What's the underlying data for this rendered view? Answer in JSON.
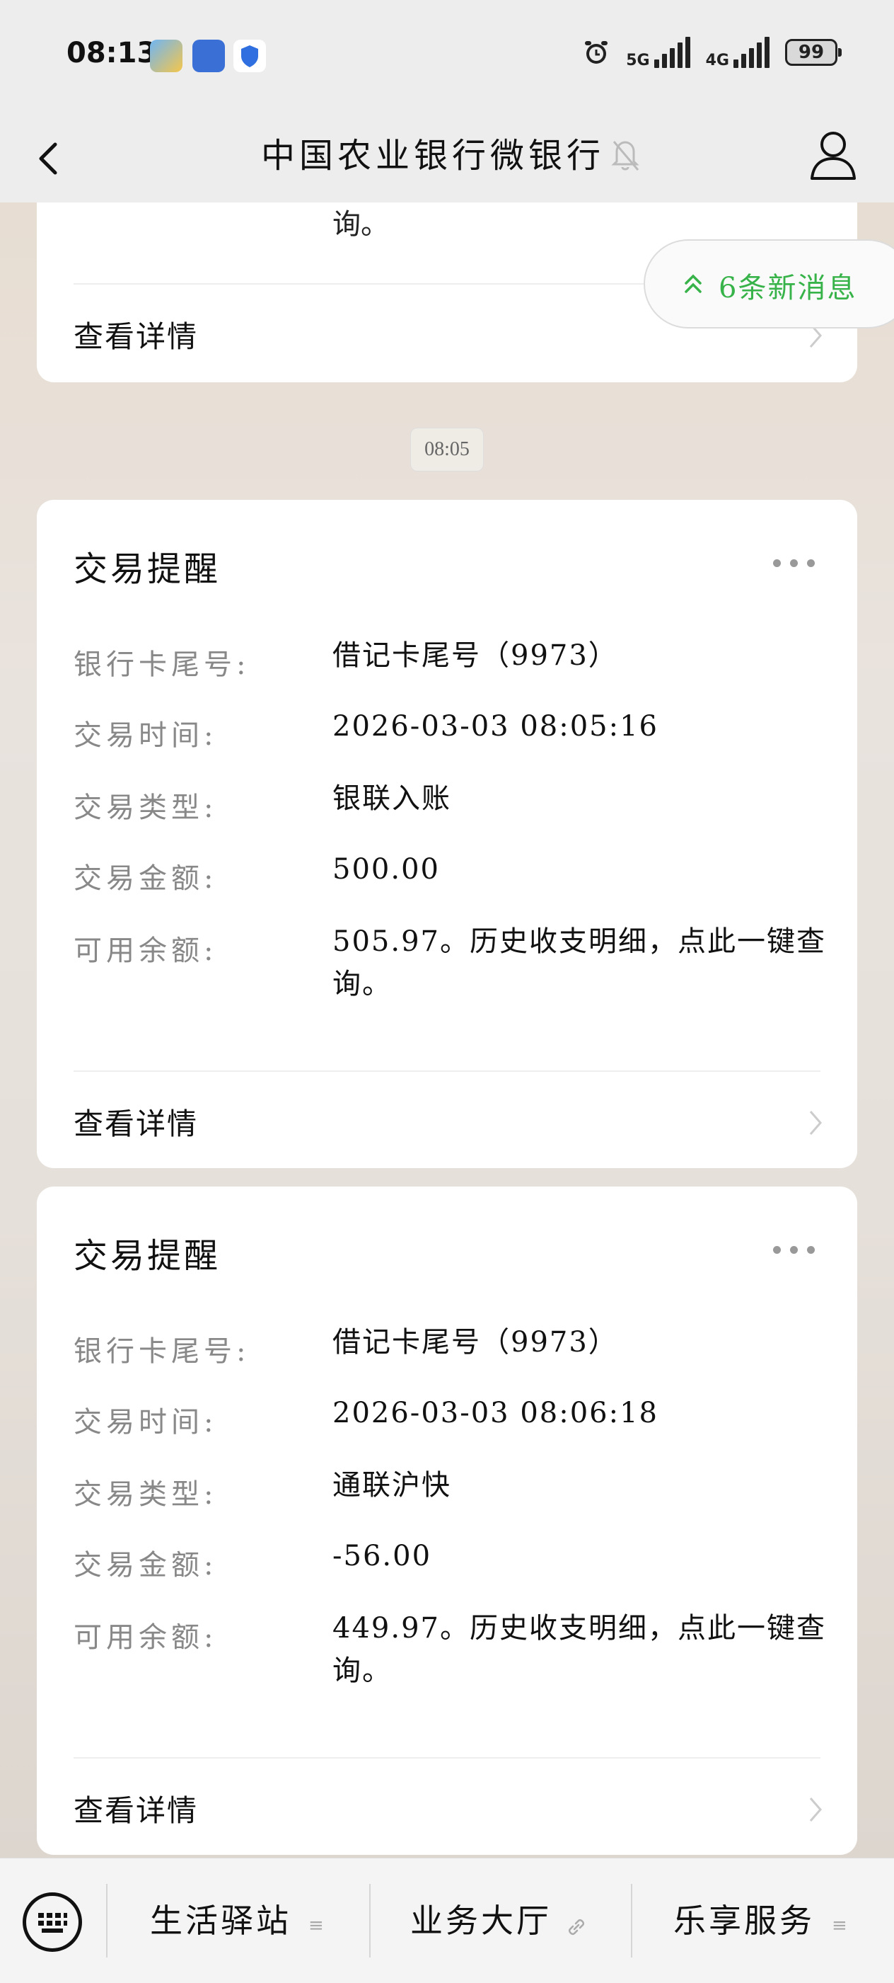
{
  "status": {
    "time": "08:13",
    "net1": "5G",
    "net2": "4G",
    "battery": "99"
  },
  "header": {
    "title": "中国农业银行微银行"
  },
  "top_card": {
    "partial_text": "询。",
    "link": "查看详情"
  },
  "new_messages": "6条新消息",
  "timestamp": "08:05",
  "cards": [
    {
      "title": "交易提醒",
      "rows": [
        {
          "label": "银行卡尾号:",
          "value": "借记卡尾号（9973）"
        },
        {
          "label": "交易时间:",
          "value": "2026-03-03 08:05:16"
        },
        {
          "label": "交易类型:",
          "value": "银联入账"
        },
        {
          "label": "交易金额:",
          "value": "500.00"
        },
        {
          "label": "可用余额:",
          "value": "505.97。历史收支明细，点此一键查询。"
        }
      ],
      "link": "查看详情"
    },
    {
      "title": "交易提醒",
      "rows": [
        {
          "label": "银行卡尾号:",
          "value": "借记卡尾号（9973）"
        },
        {
          "label": "交易时间:",
          "value": "2026-03-03 08:06:18"
        },
        {
          "label": "交易类型:",
          "value": "通联沪快"
        },
        {
          "label": "交易金额:",
          "value": "-56.00"
        },
        {
          "label": "可用余额:",
          "value": "449.97。历史收支明细，点此一键查询。"
        }
      ],
      "link": "查看详情"
    }
  ],
  "bottom_menu": [
    {
      "label": "生活驿站",
      "icon": "menu-lines-icon"
    },
    {
      "label": "业务大厅",
      "icon": "link-icon"
    },
    {
      "label": "乐享服务",
      "icon": "menu-lines-icon"
    }
  ],
  "colors": {
    "accent_green": "#37b349"
  }
}
